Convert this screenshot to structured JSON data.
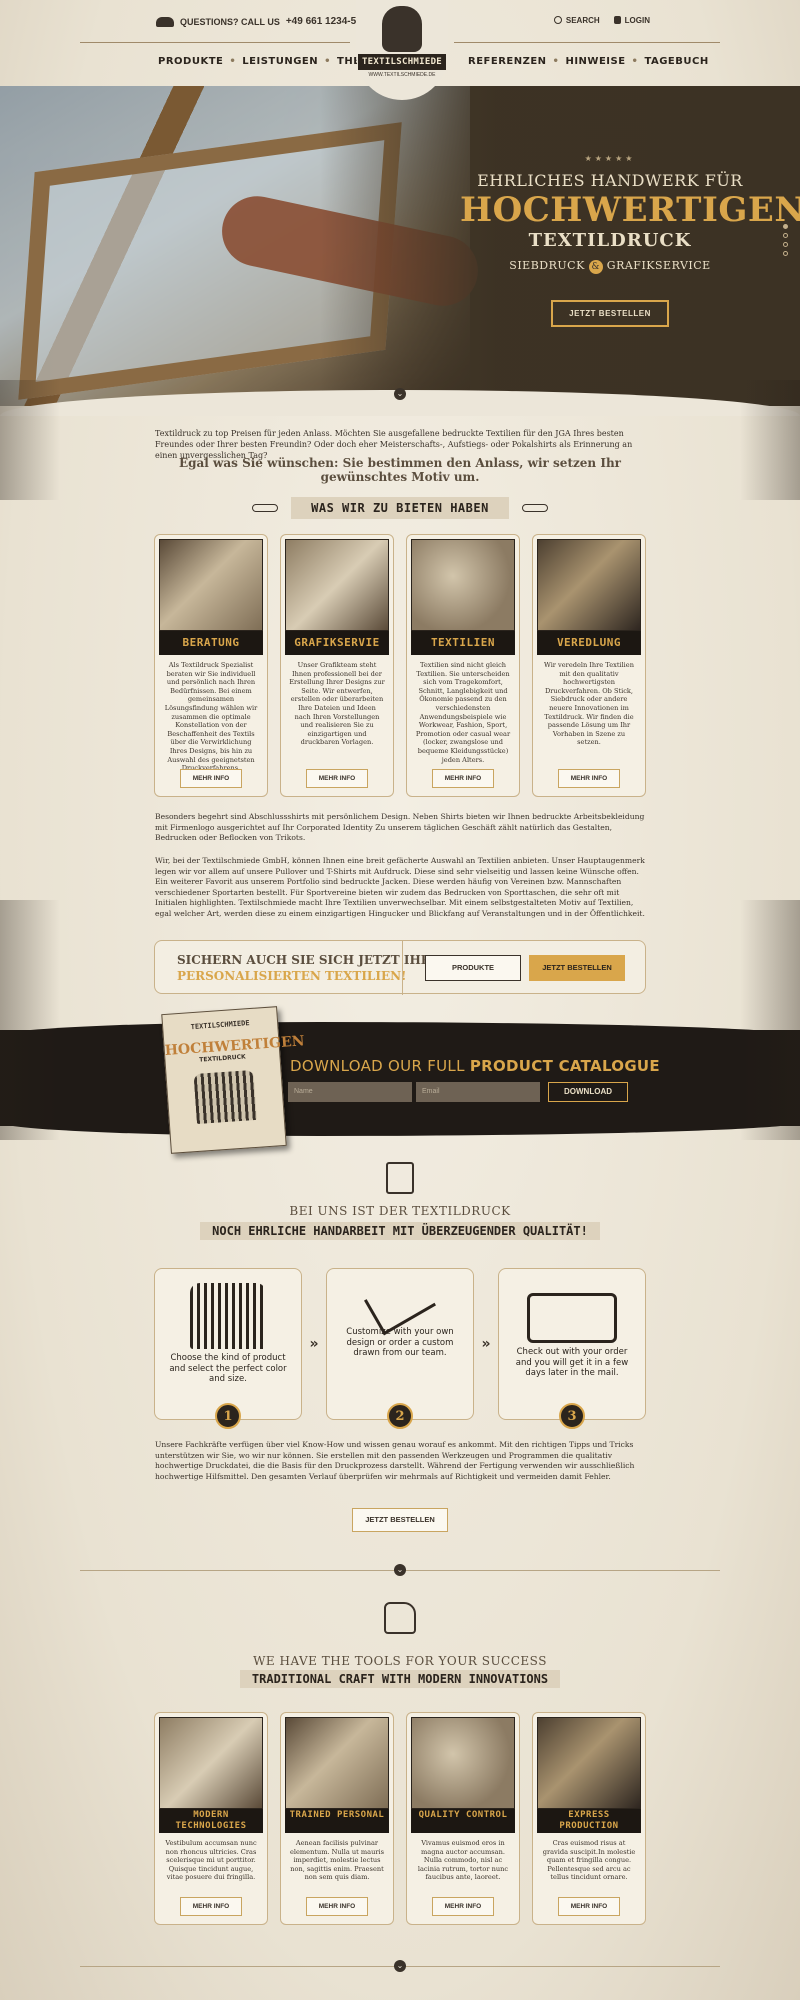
{
  "header": {
    "phone_label": "QUESTIONS? CALL US",
    "phone_number": "+49 661 1234-567",
    "search_label": "SEARCH",
    "login_label": "LOGIN",
    "nav_left": [
      "PRODUKTE",
      "LEISTUNGEN",
      "THEMEN"
    ],
    "nav_right": [
      "REFERENZEN",
      "HINWEISE",
      "TAGEBUCH"
    ],
    "logo_text": "TEXTILSCHMIEDE",
    "logo_url": "WWW.TEXTILSCHMIEDE.DE"
  },
  "hero": {
    "stars": "★★★★★",
    "line1": "EHRLICHES HANDWERK FÜR",
    "line2": "HOCHWERTIGEN",
    "line3": "TEXTILDRUCK",
    "line4_a": "SIEBDRUCK",
    "line4_amp": "&",
    "line4_b": "GRAFIKSERVICE",
    "cta": "JETZT BESTELLEN",
    "scroll": "⌄"
  },
  "intro": {
    "text": "Textildruck zu top Preisen für jeden Anlass. Möchten Sie ausgefallene bedruckte Textilien für den JGA Ihres besten Freundes oder Ihrer besten Freundin? Oder doch eher Meisterschafts-, Aufstiegs- oder Pokalshirts als Erinnerung an einen unvergesslichen Tag?",
    "strong": "Egal was Sie wünschen: Sie bestimmen den Anlass, wir setzen Ihr gewünschtes Motiv um."
  },
  "offer": {
    "heading": "WAS WIR ZU BIETEN HABEN",
    "cards": [
      {
        "title": "BERATUNG",
        "text": "Als Textildruck Spezialist beraten wir Sie individuell und persönlich nach Ihren Bedürfnissen. Bei einem gemeinsamen Lösungsfindung wählen wir zusammen die optimale Konstellation von der Beschaffenheit des Textils über die Verwirklichung Ihres Designs, bis hin zu Auswahl des geeignetsten Druckverfahrens.",
        "button": "MEHR INFO"
      },
      {
        "title": "GRAFIKSERVIE",
        "text": "Unser Grafikteam steht Ihnen professionell bei der Erstellung Ihrer Designs zur Seite. Wir entwerfen, erstellen oder überarbeiten Ihre Dateien und Ideen nach Ihren Vorstellungen und realisieren Sie zu einzigartigen und druckbaren Vorlagen.",
        "button": "MEHR INFO"
      },
      {
        "title": "TEXTILIEN",
        "text": "Textilien sind nicht gleich Textilien. Sie unterscheiden sich vom Tragekomfort, Schnitt, Langlebigkeit und Ökonomie passend zu den verschiedensten Anwendungsbeispiele wie Workwear, Fashion, Sport, Promotion oder casual wear (locker, zwangslose und bequeme Kleidungsstücke) jeden Alters.",
        "button": "MEHR INFO"
      },
      {
        "title": "VEREDLUNG",
        "text": "Wir veredeln Ihre Textilien mit den qualitativ hochwertigsten Druckverfahren. Ob Stick, Siebdruck oder andere neuere Innovationen im Textildruck. Wir finden die passende Lösung um Ihr Vorhaben in Szene zu setzen.",
        "button": "MEHR INFO"
      }
    ]
  },
  "body_text": {
    "p1": "Besonders begehrt sind Abschlussshirts mit persönlichem Design. Neben Shirts bieten wir Ihnen bedruckte Arbeitsbekleidung mit Firmenlogo ausgerichtet auf Ihr Corporated Identity Zu unserem täglichen Geschäft zählt natürlich das Gestalten, Bedrucken oder Beflocken von Trikots.",
    "p2": "Wir, bei der Textilschmiede GmbH, können Ihnen eine breit gefächerte Auswahl an Textilien anbieten. Unser Hauptaugenmerk legen wir vor allem auf unsere Pullover und T-Shirts mit Aufdruck. Diese sind sehr vielseitig und lassen keine Wünsche offen. Ein weiterer Favorit aus unserem Portfolio sind bedruckte Jacken. Diese werden häufig von Vereinen bzw. Mannschaften verschiedener Sportarten bestellt. Für Sportvereine bieten wir zudem das Bedrucken von Sporttaschen, die sehr oft mit Initialen highlighten. Textilschmiede macht Ihre Textilien unverwechselbar. Mit einem selbstgestalteten Motiv auf Textilien, egal welcher Art, werden diese zu einem einzigartigen Hingucker und Blickfang auf Veranstaltungen und in der Öffentlichkeit."
  },
  "cta": {
    "line1": "SICHERN AUCH SIE SICH JETZT IHRE",
    "line2": "PERSONALISIERTEN TEXTILIEN!",
    "products": "PRODUKTE",
    "order": "JETZT BESTELLEN"
  },
  "catalogue": {
    "title_a": "DOWNLOAD OUR FULL ",
    "title_b": "PRODUCT CATALOGUE",
    "name_placeholder": "Name",
    "email_placeholder": "Email",
    "button": "DOWNLOAD",
    "book_top": "TEXTILSCHMIEDE",
    "book_title": "HOCHWERTIGEN",
    "book_sub": "TEXTILDRUCK"
  },
  "process": {
    "head1": "BEI UNS IST DER TEXTILDRUCK",
    "head2": "NOCH EHRLICHE HANDARBEIT MIT ÜBERZEUGENDER QUALITÄT!",
    "steps": [
      {
        "text": "Choose the kind of product and select the perfect color and size.",
        "num": "1"
      },
      {
        "text": "Customize with your own design or order a custom drawn from our team.",
        "num": "2"
      },
      {
        "text": "Check out with your order and you will get it in a few days later in the mail.",
        "num": "3"
      }
    ],
    "arrow": "»",
    "paragraph": "Unsere Fachkräfte verfügen über viel Know-How und wissen genau worauf es ankommt. Mit den richtigen Tipps und Tricks unterstützen wir Sie, wo wir nur können. Sie erstellen mit den passenden Werkzeugen und Programmen die qualitativ hochwertige Druckdatei, die die Basis für den Druckprozess darstellt. Während der Fertigung verwenden wir ausschließlich hochwertige Hilfsmittel. Den gesamten Verlauf überprüfen wir mehrmals auf Richtigkeit und vermeiden damit Fehler.",
    "button": "JETZT BESTELLEN"
  },
  "tools": {
    "head1": "WE HAVE THE TOOLS FOR YOUR SUCCESS",
    "head2": "TRADITIONAL CRAFT WITH MODERN INNOVATIONS",
    "cards": [
      {
        "title": "MODERN TECHNOLOGIES",
        "text": "Vestibulum accumsan nunc non rhoncus ultricies. Cras scelerisque mi ut porttitor. Quisque tincidunt augue, vitae posuere dui fringilla.",
        "button": "MEHR INFO"
      },
      {
        "title": "TRAINED PERSONAL",
        "text": "Aenean facilisis pulvinar elementum. Nulla ut mauris imperdiet, molestie lectus non, sagittis enim. Praesent non sem quis diam.",
        "button": "MEHR INFO"
      },
      {
        "title": "QUALITY CONTROL",
        "text": "Vivamus euismod eros in magna auctor accumsan. Nulla commodo, nisl ac lacinia rutrum, tortor nunc faucibus ante, laoreet.",
        "button": "MEHR INFO"
      },
      {
        "title": "EXPRESS PRODUCTION",
        "text": "Cras euismod risus at gravida suscipit.In molestie quam et fringilla congue. Pellentesque sed arcu ac tellus tincidunt ornare.",
        "button": "MEHR INFO"
      }
    ]
  }
}
